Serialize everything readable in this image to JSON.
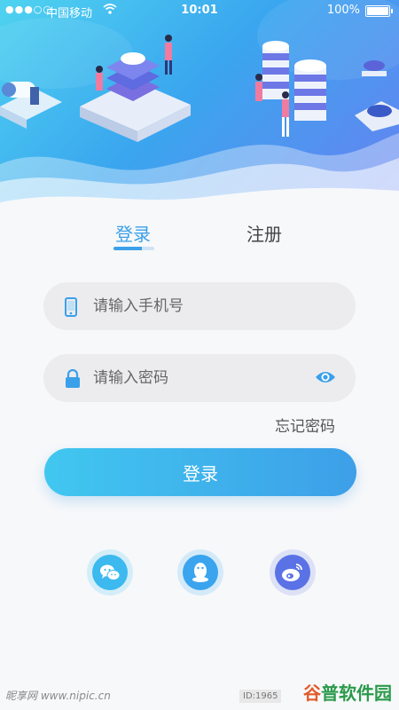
{
  "status_bar": {
    "signal": "●●●○○",
    "carrier": "中国移动",
    "time": "10:01",
    "battery": "100%"
  },
  "tabs": {
    "login": "登录",
    "register": "注册"
  },
  "form": {
    "phone_placeholder": "请输入手机号",
    "password_placeholder": "请输入密码",
    "forgot_password": "忘记密码",
    "submit": "登录"
  },
  "social": {
    "icons": [
      "wechat-icon",
      "qq-icon",
      "weibo-icon"
    ]
  },
  "watermark": {
    "left": "昵享网 www.nipic.cn",
    "id": "ID:1965",
    "right_a": "谷",
    "right_b": "普软件园"
  },
  "colors": {
    "accent": "#3aa0ea",
    "header_start": "#4fd3f0",
    "header_end": "#6a7ff0"
  }
}
